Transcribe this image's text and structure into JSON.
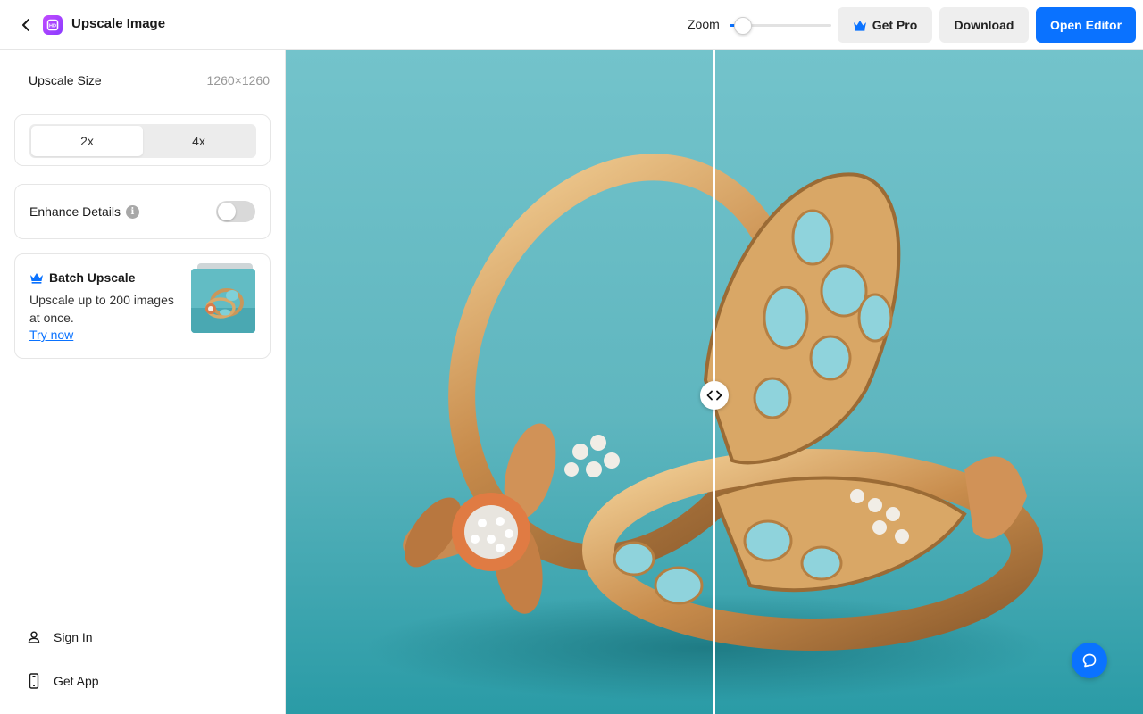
{
  "header": {
    "title": "Upscale Image",
    "zoom_label": "Zoom",
    "zoom_level": 0.05,
    "get_pro_label": "Get Pro",
    "download_label": "Download",
    "open_editor_label": "Open Editor"
  },
  "sidebar": {
    "upscale_size_label": "Upscale Size",
    "upscale_size_value": "1260×1260",
    "scale_options": [
      {
        "label": "2x",
        "selected": true
      },
      {
        "label": "4x",
        "selected": false
      }
    ],
    "enhance_details_label": "Enhance Details",
    "enhance_details_on": false,
    "batch": {
      "title": "Batch Upscale",
      "description": "Upscale up to 200 images at once.",
      "link": "Try now"
    },
    "nav": {
      "sign_in": "Sign In",
      "get_app": "Get App"
    }
  },
  "canvas": {
    "compare_position": 0.5,
    "image_subject": "gold rings with turquoise enamel and diamonds on teal background"
  },
  "colors": {
    "accent": "#0a72ff",
    "pro_crown": "#0a72ff",
    "logo_gradient_start": "#c24bff",
    "logo_gradient_end": "#8a3bff",
    "background_teal": "#5cb8c2"
  },
  "icons": {
    "back": "chevron-left-icon",
    "logo": "upscale-logo-icon",
    "crown": "crown-icon",
    "info": "info-icon",
    "user": "user-icon",
    "phone": "phone-icon",
    "compare": "compare-arrows-icon",
    "chat": "chat-icon"
  }
}
